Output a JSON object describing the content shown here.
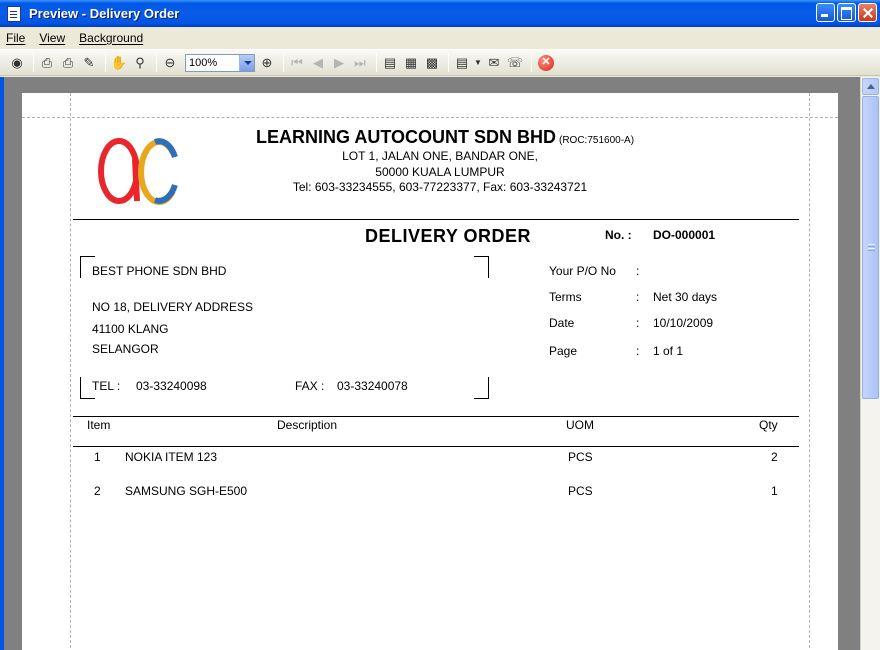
{
  "window": {
    "title": "Preview - Delivery Order"
  },
  "menu": [
    "File",
    "View",
    "Background"
  ],
  "toolbar": {
    "zoom": "100%"
  },
  "company": {
    "name": "LEARNING AUTOCOUNT SDN BHD",
    "roc": "(ROC:751600-A)",
    "address1": "LOT 1, JALAN ONE,  BANDAR ONE,",
    "address2": "50000  KUALA LUMPUR",
    "contact": "Tel:  603-33234555,  603-77223377,  Fax: 603-33243721",
    "logo_text": "ac"
  },
  "document": {
    "title": "DELIVERY  ORDER",
    "no_label": "No.  :",
    "no_value": "DO-000001"
  },
  "customer": {
    "name": "BEST PHONE SDN BHD",
    "address1": "NO 18, DELIVERY ADDRESS",
    "address2": "41100 KLANG",
    "address3": "SELANGOR",
    "tel_label": "TEL :",
    "tel_value": "03-33240098",
    "fax_label": "FAX  :",
    "fax_value": "03-33240078"
  },
  "info": [
    {
      "label": "Your P/O No",
      "colon": ":",
      "value": ""
    },
    {
      "label": "Terms",
      "colon": ":",
      "value": "Net 30 days"
    },
    {
      "label": "Date",
      "colon": ":",
      "value": "10/10/2009"
    },
    {
      "label": "Page",
      "colon": ":",
      "value": "1 of 1"
    }
  ],
  "table": {
    "headers": {
      "item": "Item",
      "description": "Description",
      "uom": "UOM",
      "qty": "Qty"
    },
    "rows": [
      {
        "item": "1",
        "description": "NOKIA ITEM 123",
        "uom": "PCS",
        "qty": "2"
      },
      {
        "item": "2",
        "description": "SAMSUNG SGH-E500",
        "uom": "PCS",
        "qty": "1"
      }
    ]
  },
  "colors": {
    "logo_red": "#e8262b",
    "logo_blue": "#2f6fb7",
    "logo_gold": "#e6a91e"
  }
}
